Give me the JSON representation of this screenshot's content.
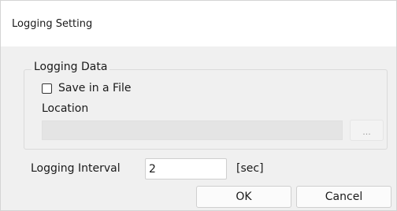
{
  "dialog": {
    "title": "Logging Setting"
  },
  "logging_data": {
    "legend": "Logging Data",
    "save_in_file_label": "Save in a File",
    "save_in_file_checked": false,
    "location_label": "Location",
    "location_value": "",
    "browse_label": "..."
  },
  "interval": {
    "label": "Logging Interval",
    "value": "2",
    "unit": "[sec]"
  },
  "buttons": {
    "ok_label": "OK",
    "cancel_label": "Cancel"
  }
}
